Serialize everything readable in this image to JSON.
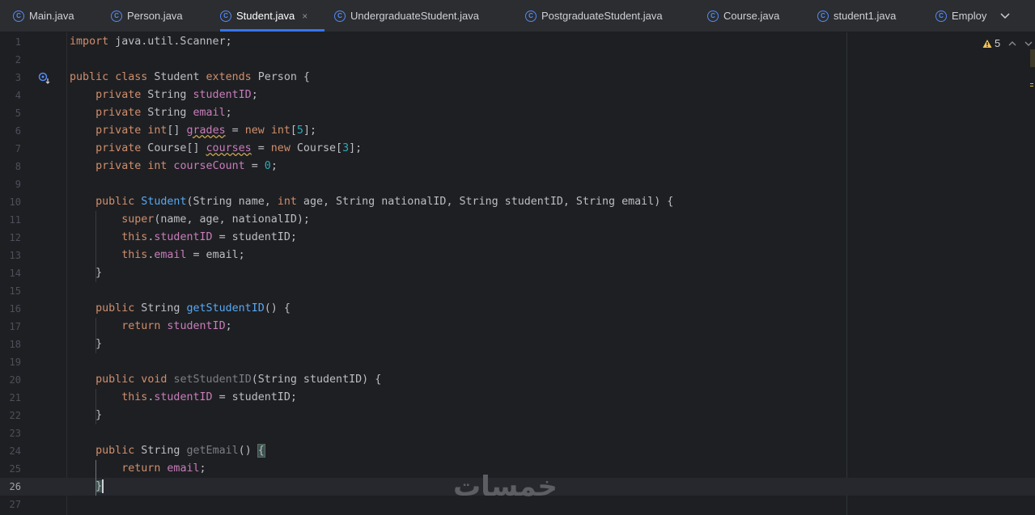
{
  "tabs": [
    {
      "label": "Main.java",
      "icon": "class-icon"
    },
    {
      "label": "Person.java",
      "icon": "class-icon"
    },
    {
      "label": "Student.java",
      "icon": "class-icon",
      "active": true
    },
    {
      "label": "UndergraduateStudent.java",
      "icon": "class-icon"
    },
    {
      "label": "PostgraduateStudent.java",
      "icon": "class-icon"
    },
    {
      "label": "Course.java",
      "icon": "class-icon"
    },
    {
      "label": "student1.java",
      "icon": "class-icon"
    },
    {
      "label": "Employ",
      "icon": "class-icon"
    }
  ],
  "tab_close": "×",
  "warnings": {
    "count": "5",
    "icon": "warning-icon"
  },
  "colors": {
    "keyword": "#cf8e6d",
    "field": "#c77dbb",
    "method": "#56a8f5",
    "number": "#2aacb8",
    "text": "#bcbec4",
    "accent": "#3574f0"
  },
  "code_lines": [
    "import java.util.Scanner;",
    "",
    "public class Student extends Person {",
    "    private String studentID;",
    "    private String email;",
    "    private int[] grades = new int[5];",
    "    private Course[] courses = new Course[3];",
    "    private int courseCount = 0;",
    "",
    "    public Student(String name, int age, String nationalID, String studentID, String email) {",
    "        super(name, age, nationalID);",
    "        this.studentID = studentID;",
    "        this.email = email;",
    "    }",
    "",
    "    public String getStudentID() {",
    "        return studentID;",
    "    }",
    "",
    "    public void setStudentID(String studentID) {",
    "        this.studentID = studentID;",
    "    }",
    "",
    "    public String getEmail() {",
    "        return email;",
    "    }",
    ""
  ],
  "current_line": 26,
  "watermark": "خمسات"
}
